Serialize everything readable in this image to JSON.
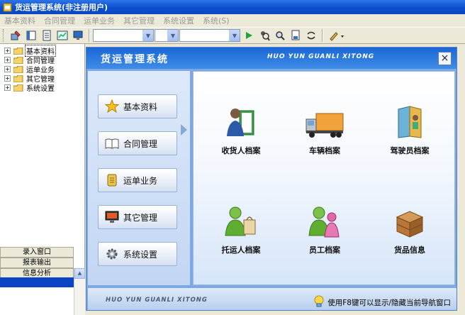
{
  "window": {
    "title": "货运管理系统(非注册用户)"
  },
  "menu": [
    "基本资料",
    "合同管理",
    "运单业务",
    "其它管理",
    "系统设置",
    "系统(S)"
  ],
  "toolbar": {
    "icons": [
      "tool-icon",
      "book-icon",
      "document-icon",
      "chart-icon",
      "monitor-icon"
    ],
    "combos": [
      {
        "value": ""
      },
      {
        "value": ""
      },
      {
        "value": ""
      }
    ],
    "right_icons": [
      "play-icon",
      "search-person-icon",
      "search-icon",
      "report-icon",
      "refresh-icon",
      "pen-icon"
    ]
  },
  "tree": {
    "items": [
      {
        "label": "基本资料",
        "selected": true
      },
      {
        "label": "合同管理"
      },
      {
        "label": "运单业务"
      },
      {
        "label": "其它管理"
      },
      {
        "label": "系统设置"
      }
    ]
  },
  "nav": {
    "entry_window": "录入窗口",
    "report_output": "报表输出",
    "info_analysis": "信息分析"
  },
  "dialog": {
    "title": "货运管理系统",
    "pinyin": "HUO YUN GUANLI XITONG",
    "close": "×",
    "side_buttons": [
      {
        "label": "基本资料",
        "icon": "star-icon",
        "active": true
      },
      {
        "label": "合同管理",
        "icon": "open-book-icon"
      },
      {
        "label": "运单业务",
        "icon": "scroll-icon"
      },
      {
        "label": "其它管理",
        "icon": "computer-icon"
      },
      {
        "label": "系统设置",
        "icon": "gear-icon"
      }
    ],
    "items": [
      {
        "label": "收货人档案",
        "icon": "receiver-icon"
      },
      {
        "label": "车辆档案",
        "icon": "truck-icon"
      },
      {
        "label": "驾驶员档案",
        "icon": "driver-file-icon"
      },
      {
        "label": "托运人档案",
        "icon": "shipper-icon"
      },
      {
        "label": "员工档案",
        "icon": "staff-icon"
      },
      {
        "label": "货品信息",
        "icon": "crate-icon"
      }
    ],
    "footer_pinyin": "HUO YUN GUANLI XITONG",
    "footer_tip": "使用F8键可以显示/隐藏当前导航窗口"
  }
}
